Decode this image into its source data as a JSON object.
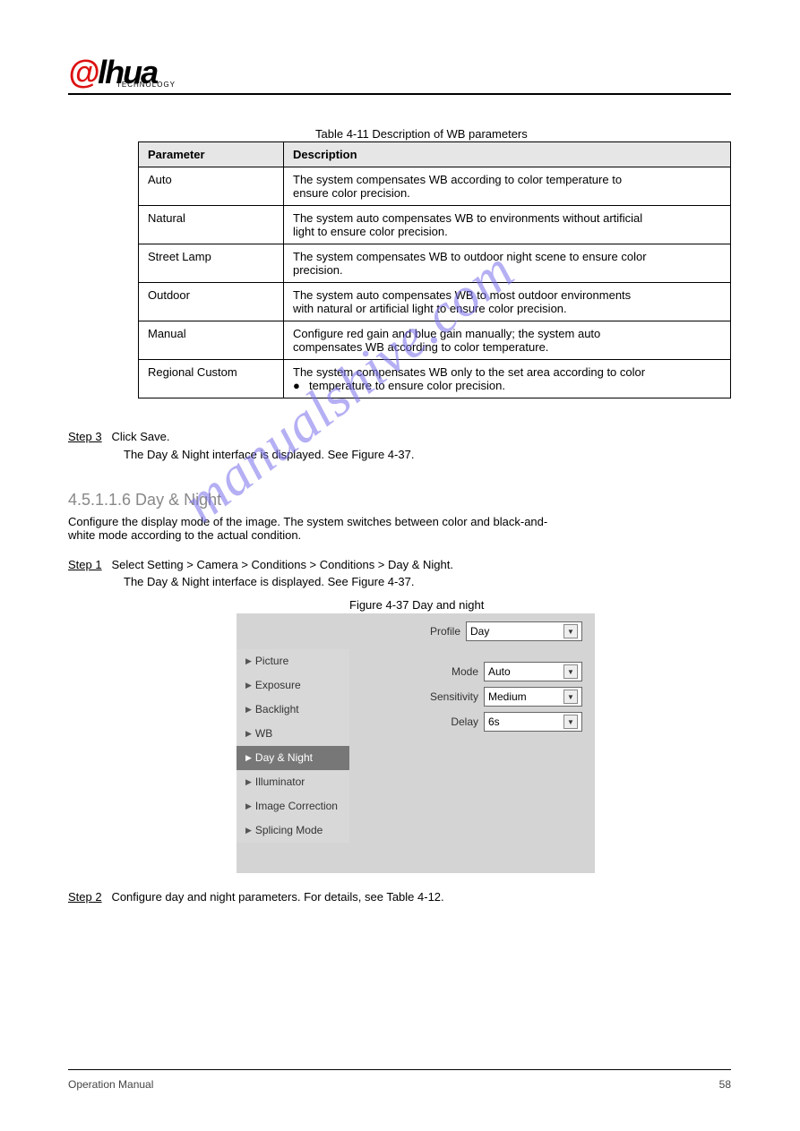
{
  "header": {
    "logoA": "@",
    "logoHua": "lhua",
    "logoSub": "TECHNOLOGY"
  },
  "table": {
    "caption": "Table 4-11 Description of WB parameters",
    "headers": [
      "Parameter",
      "Description"
    ],
    "rows": [
      {
        "param": "Auto",
        "desc": [
          "The system compensates WB according to color temperature to",
          "ensure color precision."
        ]
      },
      {
        "param": "Natural",
        "desc": [
          "The system auto compensates WB to environments without artificial",
          "light to ensure color precision."
        ]
      },
      {
        "param": "Street Lamp",
        "desc": [
          "The system compensates WB to outdoor night scene to ensure color",
          "precision."
        ]
      },
      {
        "param": "Outdoor",
        "desc": [
          "The system auto compensates WB to most outdoor environments",
          "with natural or artificial light to ensure color precision."
        ]
      },
      {
        "param": "Manual",
        "desc": [
          "Configure red gain and blue gain manually; the system auto",
          "compensates WB according to color temperature."
        ]
      },
      {
        "param": "Regional Custom",
        "bullet": "●",
        "desc": [
          "The system compensates WB only to the set area according to color",
          "temperature to ensure color precision."
        ]
      }
    ]
  },
  "steps": {
    "s3": {
      "label": "Step 3",
      "text": "Click Save.",
      "body": "The Day & Night interface is displayed. See Figure 4-37."
    },
    "s1": {
      "label": "Step 1",
      "text": "Select Setting > Camera > Conditions > Conditions > Day & Night.",
      "body": "The Day & Night interface is displayed. See Figure 4-37."
    },
    "s2": {
      "label": "Step 2",
      "text": "Configure day and night parameters. For details, see Table 4-12."
    }
  },
  "section": {
    "heading": "4.5.1.1.6 Day & Night",
    "intro1": "Configure the display mode of the image. The system switches between color and black-and-",
    "intro2": "white mode according to the actual condition."
  },
  "figure": {
    "caption": "Figure 4-37 Day and night"
  },
  "panel": {
    "profileLabel": "Profile",
    "profileValue": "Day",
    "sidebar": [
      "Picture",
      "Exposure",
      "Backlight",
      "WB",
      "Day & Night",
      "Illuminator",
      "Image Correction",
      "Splicing Mode"
    ],
    "fields": [
      {
        "label": "Mode",
        "value": "Auto"
      },
      {
        "label": "Sensitivity",
        "value": "Medium"
      },
      {
        "label": "Delay",
        "value": "6s"
      }
    ]
  },
  "footer": {
    "left": "Operation Manual",
    "right": "58"
  },
  "watermark": "manualshive.com"
}
